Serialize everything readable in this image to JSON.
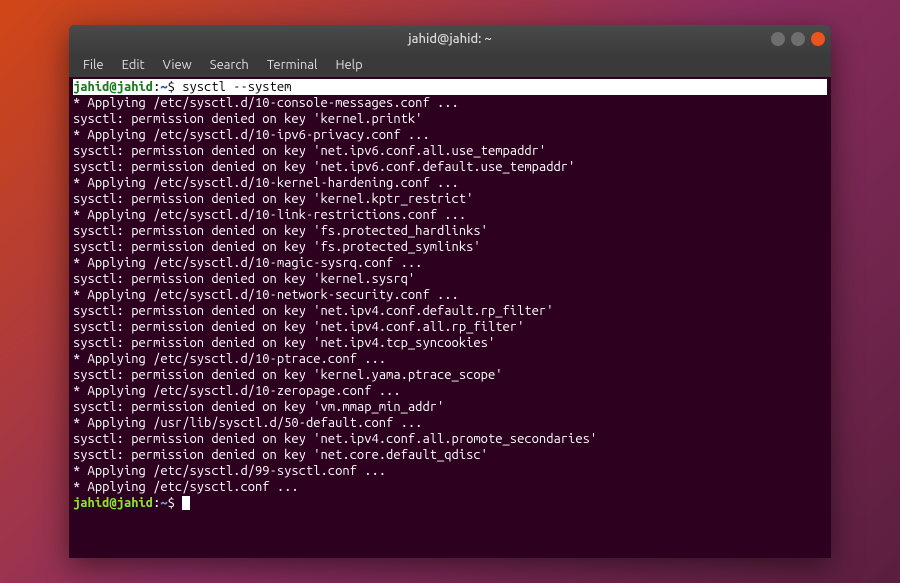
{
  "titlebar": {
    "title": "jahid@jahid: ~"
  },
  "menu": {
    "file": "File",
    "edit": "Edit",
    "view": "View",
    "search": "Search",
    "terminal": "Terminal",
    "help": "Help"
  },
  "prompt": {
    "user": "jahid@jahid",
    "colon": ":",
    "path": "~",
    "dollar": "$"
  },
  "command": "sysctl --system",
  "output": [
    "* Applying /etc/sysctl.d/10-console-messages.conf ...",
    "sysctl: permission denied on key 'kernel.printk'",
    "* Applying /etc/sysctl.d/10-ipv6-privacy.conf ...",
    "sysctl: permission denied on key 'net.ipv6.conf.all.use_tempaddr'",
    "sysctl: permission denied on key 'net.ipv6.conf.default.use_tempaddr'",
    "* Applying /etc/sysctl.d/10-kernel-hardening.conf ...",
    "sysctl: permission denied on key 'kernel.kptr_restrict'",
    "* Applying /etc/sysctl.d/10-link-restrictions.conf ...",
    "sysctl: permission denied on key 'fs.protected_hardlinks'",
    "sysctl: permission denied on key 'fs.protected_symlinks'",
    "* Applying /etc/sysctl.d/10-magic-sysrq.conf ...",
    "sysctl: permission denied on key 'kernel.sysrq'",
    "* Applying /etc/sysctl.d/10-network-security.conf ...",
    "sysctl: permission denied on key 'net.ipv4.conf.default.rp_filter'",
    "sysctl: permission denied on key 'net.ipv4.conf.all.rp_filter'",
    "sysctl: permission denied on key 'net.ipv4.tcp_syncookies'",
    "* Applying /etc/sysctl.d/10-ptrace.conf ...",
    "sysctl: permission denied on key 'kernel.yama.ptrace_scope'",
    "* Applying /etc/sysctl.d/10-zeropage.conf ...",
    "sysctl: permission denied on key 'vm.mmap_min_addr'",
    "* Applying /usr/lib/sysctl.d/50-default.conf ...",
    "sysctl: permission denied on key 'net.ipv4.conf.all.promote_secondaries'",
    "sysctl: permission denied on key 'net.core.default_qdisc'",
    "* Applying /etc/sysctl.d/99-sysctl.conf ...",
    "* Applying /etc/sysctl.conf ..."
  ]
}
